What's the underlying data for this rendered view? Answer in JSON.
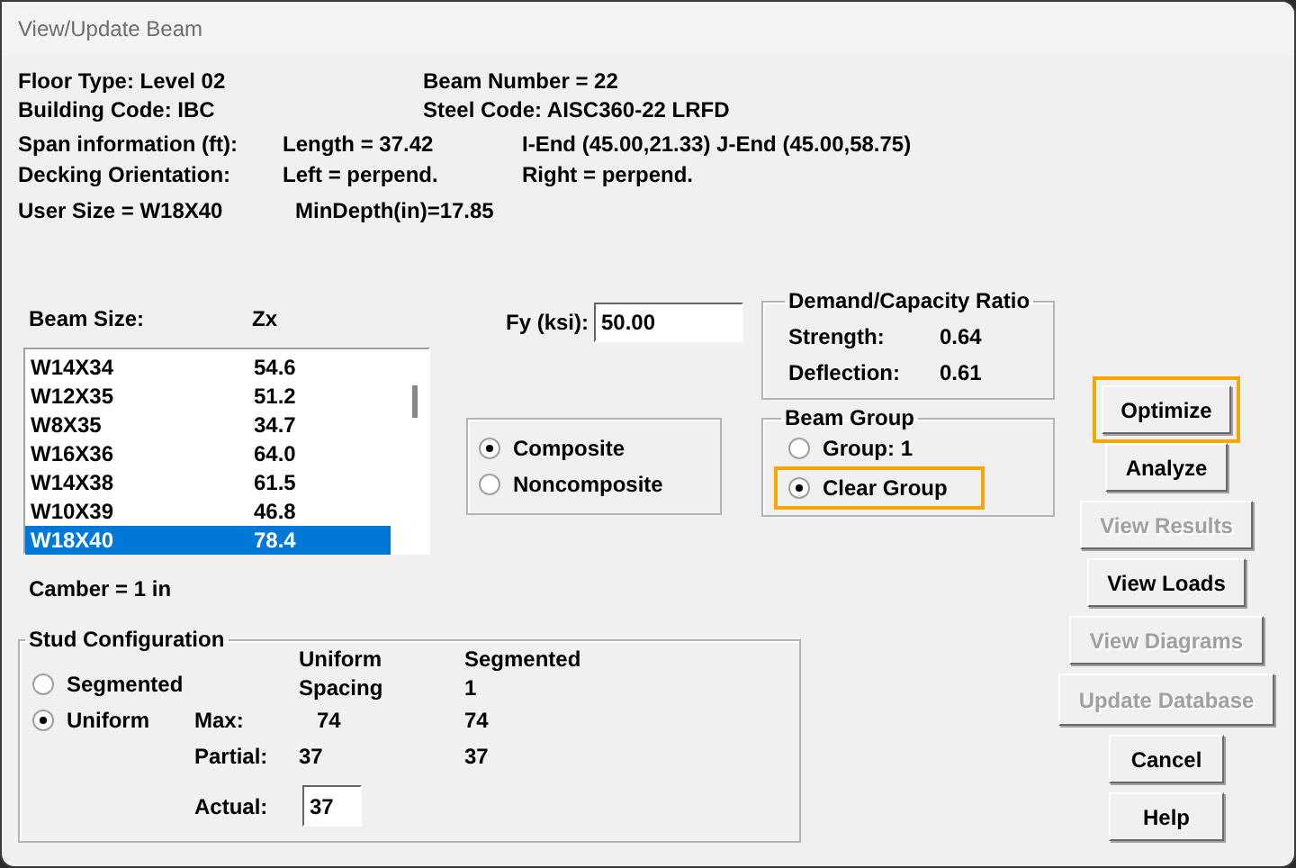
{
  "window": {
    "title": "View/Update Beam"
  },
  "info_rows": [
    {
      "kind": "pair",
      "cells": [
        "Floor Type: Level 02",
        "Beam Number = 22"
      ]
    },
    {
      "kind": "pair",
      "cells": [
        "Building Code: IBC",
        "Steel Code: AISC360-22 LRFD"
      ]
    },
    {
      "kind": "triple",
      "cells": [
        "Span information (ft):",
        "Length = 37.42",
        "I-End (45.00,21.33) J-End (45.00,58.75)"
      ]
    },
    {
      "kind": "triple",
      "cells": [
        "Decking Orientation:",
        "Left = perpend.",
        "Right = perpend."
      ]
    },
    {
      "kind": "size",
      "cells": [
        "User Size = W18X40",
        "MinDepth(in)=17.85"
      ]
    }
  ],
  "beam_list": {
    "headers": [
      "Beam Size:",
      "Zx"
    ],
    "rows": [
      {
        "size": "W14X34",
        "zx": "54.6",
        "selected": false
      },
      {
        "size": "W12X35",
        "zx": "51.2",
        "selected": false
      },
      {
        "size": "W8X35",
        "zx": "34.7",
        "selected": false
      },
      {
        "size": "W16X36",
        "zx": "64.0",
        "selected": false
      },
      {
        "size": "W14X38",
        "zx": "61.5",
        "selected": false
      },
      {
        "size": "W10X39",
        "zx": "46.8",
        "selected": false
      },
      {
        "size": "W18X40",
        "zx": "78.4",
        "selected": true
      }
    ]
  },
  "camber": "Camber = 1 in",
  "fy": {
    "label": "Fy (ksi):",
    "value": "50.00"
  },
  "section_type": {
    "options": [
      {
        "label": "Composite",
        "selected": true
      },
      {
        "label": "Noncomposite",
        "selected": false
      }
    ]
  },
  "dc_ratio": {
    "title": "Demand/Capacity Ratio",
    "rows": [
      {
        "label": "Strength:",
        "value": "0.64"
      },
      {
        "label": "Deflection:",
        "value": "0.61"
      }
    ]
  },
  "beam_group": {
    "title": "Beam Group",
    "options": [
      {
        "label": "Group: 1",
        "selected": false,
        "highlighted": false
      },
      {
        "label": "Clear Group",
        "selected": true,
        "highlighted": true
      }
    ]
  },
  "stud_config": {
    "title": "Stud Configuration",
    "options": [
      {
        "label": "Segmented",
        "selected": false
      },
      {
        "label": "Uniform",
        "selected": true
      }
    ],
    "column_headers": [
      [
        "Uniform",
        "Spacing"
      ],
      [
        "Segmented",
        "1"
      ]
    ],
    "rows": [
      {
        "label": "Max:",
        "uniform": "74",
        "segmented": "74"
      },
      {
        "label": "Partial:",
        "uniform": "37",
        "segmented": "37"
      }
    ],
    "actual": {
      "label": "Actual:",
      "value": "37"
    }
  },
  "buttons": [
    {
      "label": "Optimize",
      "disabled": false,
      "highlighted": true
    },
    {
      "label": "Analyze",
      "disabled": false,
      "highlighted": false
    },
    {
      "label": "View Results",
      "disabled": true,
      "highlighted": false
    },
    {
      "label": "View Loads",
      "disabled": false,
      "highlighted": false
    },
    {
      "label": "View Diagrams",
      "disabled": true,
      "highlighted": false
    },
    {
      "label": "Update Database",
      "disabled": true,
      "highlighted": false
    },
    {
      "label": "Cancel",
      "disabled": false,
      "highlighted": false
    },
    {
      "label": "Help",
      "disabled": false,
      "highlighted": false
    }
  ]
}
